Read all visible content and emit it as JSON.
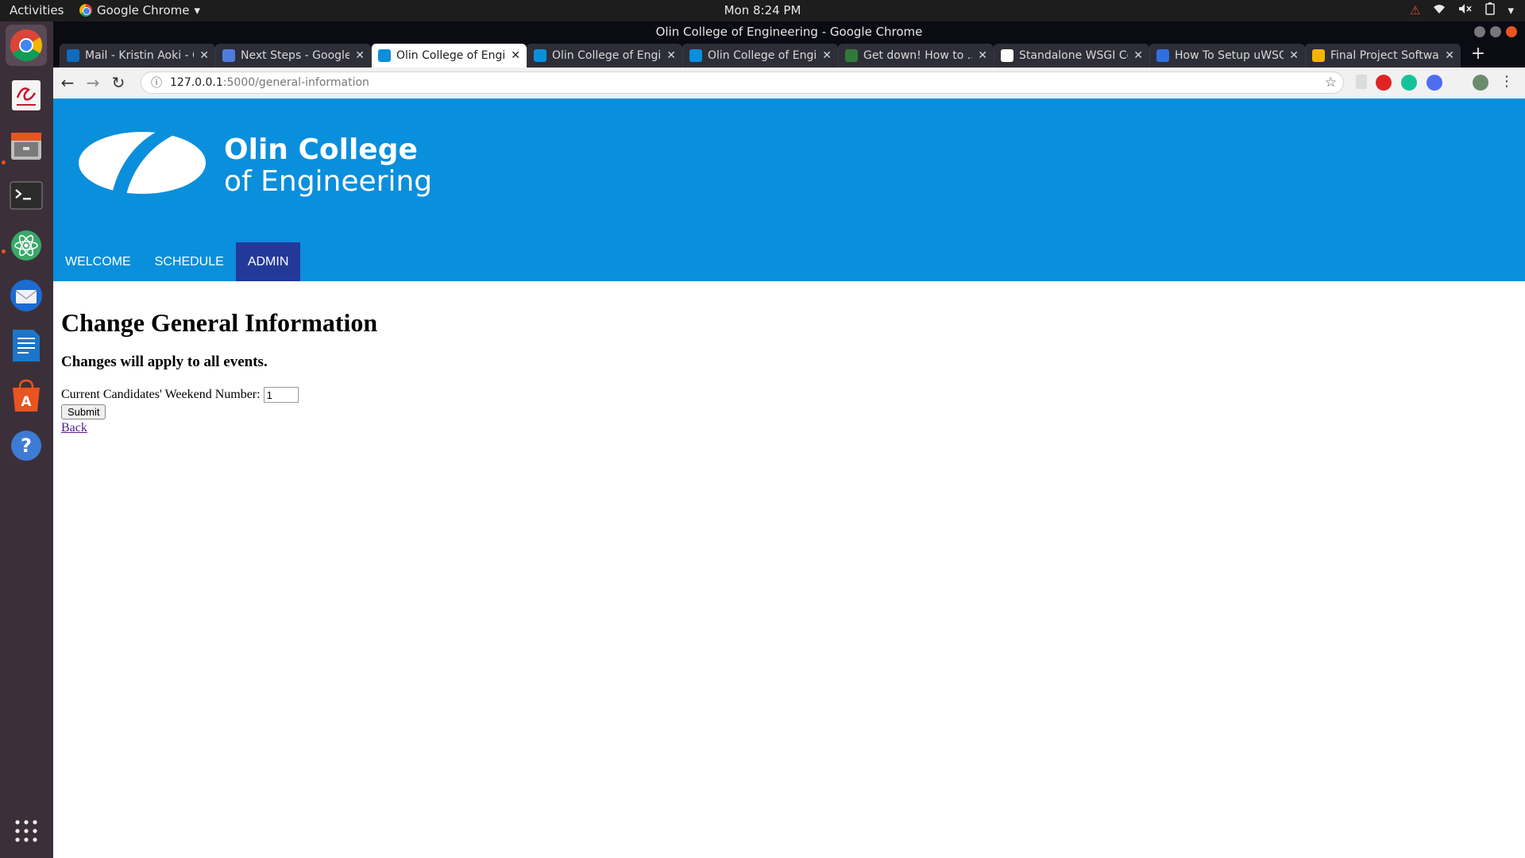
{
  "topbar": {
    "activities": "Activities",
    "app_name": "Google Chrome",
    "clock": "Mon  8:24 PM"
  },
  "window": {
    "title": "Olin College of Engineering - Google Chrome"
  },
  "tabs": [
    {
      "title": "Mail - Kristin Aoki - Outlook",
      "favicon_color": "#0f6cbd",
      "active": false
    },
    {
      "title": "Next Steps - Google Docs",
      "favicon_color": "#4f7ce0",
      "active": false
    },
    {
      "title": "Olin College of Engineering",
      "favicon_color": "#0a8fdc",
      "active": true
    },
    {
      "title": "Olin College of Engineering",
      "favicon_color": "#0a8fdc",
      "active": false
    },
    {
      "title": "Olin College of Engineering",
      "favicon_color": "#0a8fdc",
      "active": false
    },
    {
      "title": "Get down! How to ...",
      "favicon_color": "#2f7a3a",
      "active": false
    },
    {
      "title": "Standalone WSGI Containers",
      "favicon_color": "#ffffff",
      "active": false
    },
    {
      "title": "How To Setup uWSGI",
      "favicon_color": "#2f6fe0",
      "active": false
    },
    {
      "title": "Final Project Software",
      "favicon_color": "#f4b400",
      "active": false
    }
  ],
  "address_bar": {
    "host": "127.0.0.1",
    "path": ":5000/general-information"
  },
  "site": {
    "brand_line1": "Olin College",
    "brand_line2": "of Engineering",
    "nav": [
      "WELCOME",
      "SCHEDULE",
      "ADMIN"
    ],
    "active_nav": "ADMIN"
  },
  "form": {
    "heading": "Change General Information",
    "subheading": "Changes will apply to all events.",
    "field_label": "Current Candidates' Weekend Number:",
    "field_value": "1",
    "submit_label": "Submit",
    "back_label": "Back"
  },
  "colors": {
    "header_blue": "#0a8fdc",
    "nav_active": "#23399a",
    "dock_bg": "#3b3039"
  }
}
